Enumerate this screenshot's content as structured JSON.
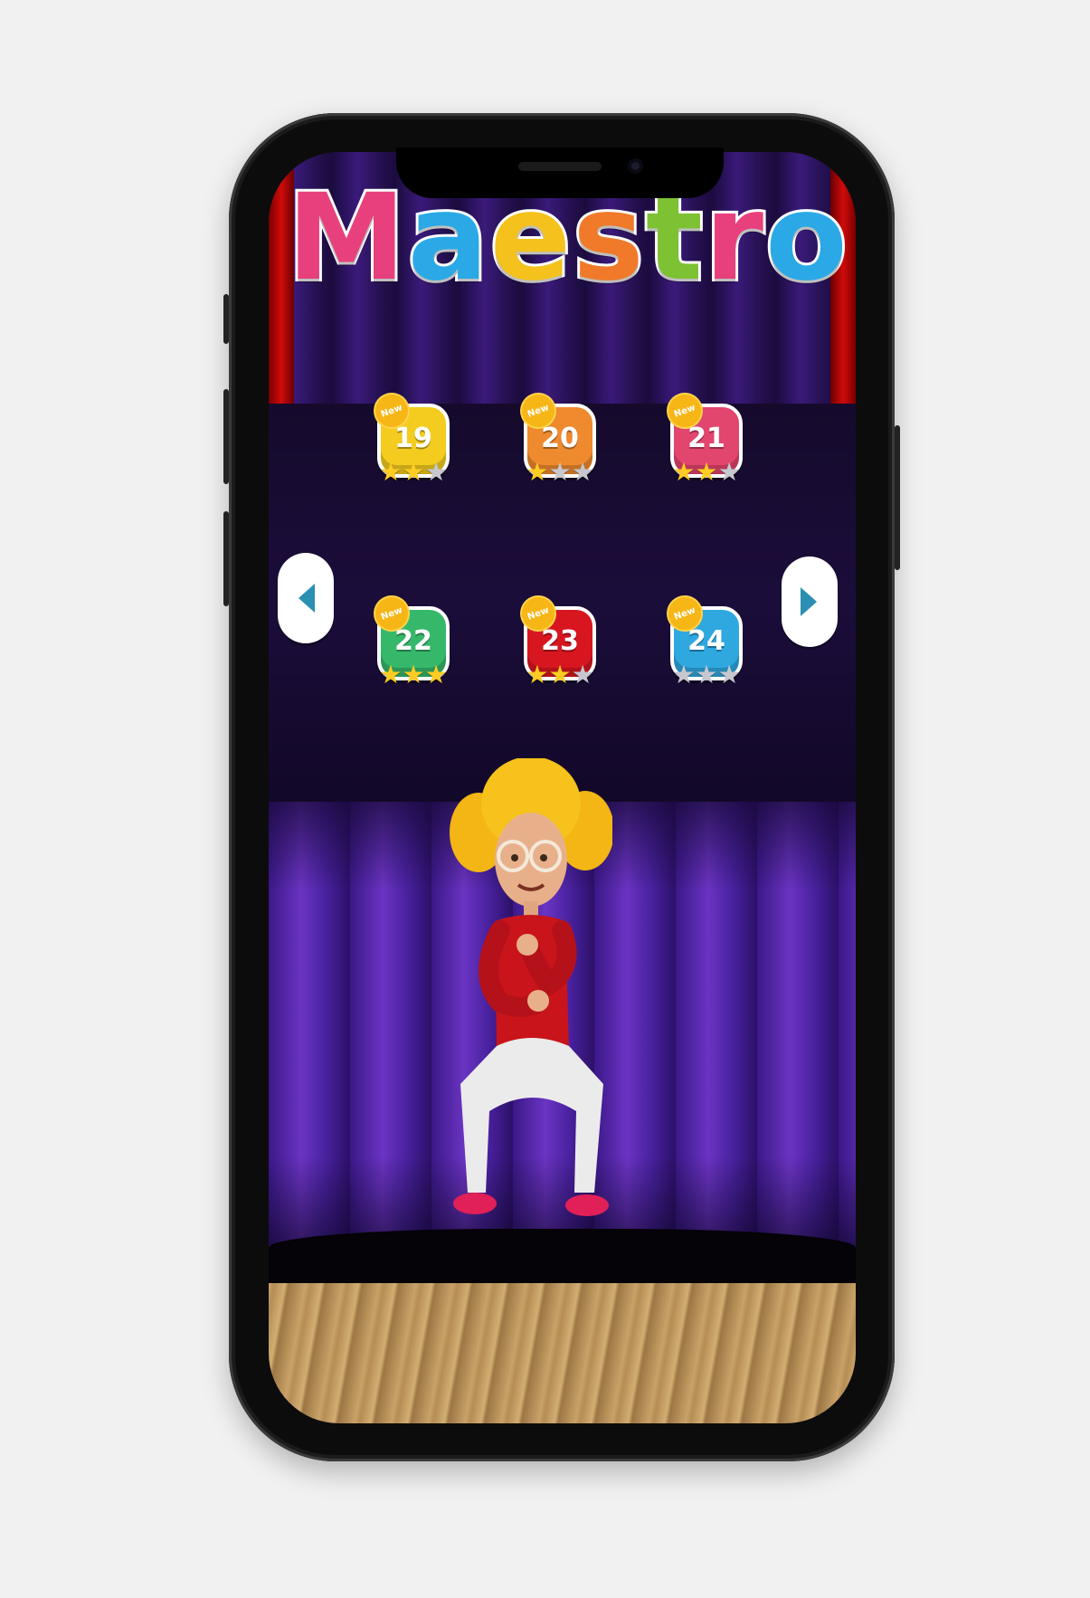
{
  "game": {
    "title_letters": [
      {
        "char": "M",
        "color": "#e8407c"
      },
      {
        "char": "a",
        "color": "#2aa9e6"
      },
      {
        "char": "e",
        "color": "#f5c11c"
      },
      {
        "char": "s",
        "color": "#f07a2a"
      },
      {
        "char": "t",
        "color": "#7cc233"
      },
      {
        "char": "r",
        "color": "#e8407c"
      },
      {
        "char": "o",
        "color": "#2aa9e6"
      }
    ],
    "new_badge": "New",
    "levels": [
      {
        "number": "19",
        "color": "#f3cc1f",
        "stars": 2,
        "is_new": true
      },
      {
        "number": "20",
        "color": "#ef8a2e",
        "stars": 1,
        "is_new": true
      },
      {
        "number": "21",
        "color": "#e2456e",
        "stars": 2,
        "is_new": true
      },
      {
        "number": "22",
        "color": "#36b86b",
        "stars": 3,
        "is_new": true
      },
      {
        "number": "23",
        "color": "#d8161f",
        "stars": 2,
        "is_new": true
      },
      {
        "number": "24",
        "color": "#2fa8e0",
        "stars": 0,
        "is_new": true
      }
    ],
    "max_stars": 3,
    "prev_icon": "arrow-left-icon",
    "next_icon": "arrow-right-icon",
    "accent_arrow_color": "#2b8fb3"
  }
}
